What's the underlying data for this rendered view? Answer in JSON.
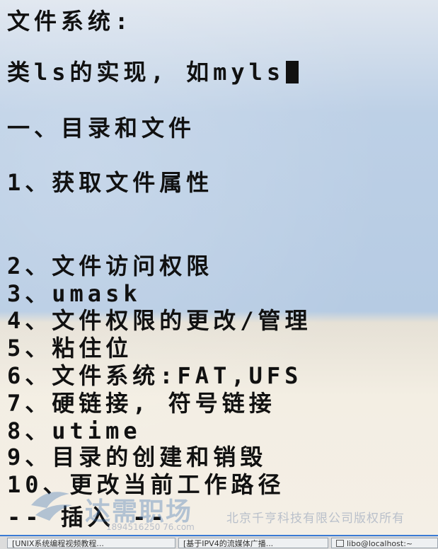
{
  "editor": {
    "lines": [
      "文件系统:",
      "类ls的实现, 如myls",
      "一、目录和文件",
      "1、获取文件属性",
      "2、文件访问权限",
      "3、umask",
      "4、文件权限的更改/管理",
      "5、粘住位",
      "6、文件系统:FAT,UFS",
      "7、硬链接, 符号链接",
      "8、utime",
      "9、目录的创建和销毁",
      "10、更改当前工作路径"
    ],
    "status": "-- 插入 --"
  },
  "watermark": {
    "brand": "达需职场",
    "company": "北京千亨科技有限公司版权所有",
    "phone": "1894516250 76.com"
  },
  "taskbar": {
    "items": [
      "[UNIX系统编程视频教程...",
      "[基于IPV4的流媒体广播...",
      "libo@localhost:~"
    ]
  },
  "colors": {
    "background_top": "#bdd0e6",
    "background_bottom": "#f3eee3",
    "text": "#111111",
    "highlight": "#e8c98a",
    "taskbar_accent": "#3a7bd5"
  }
}
